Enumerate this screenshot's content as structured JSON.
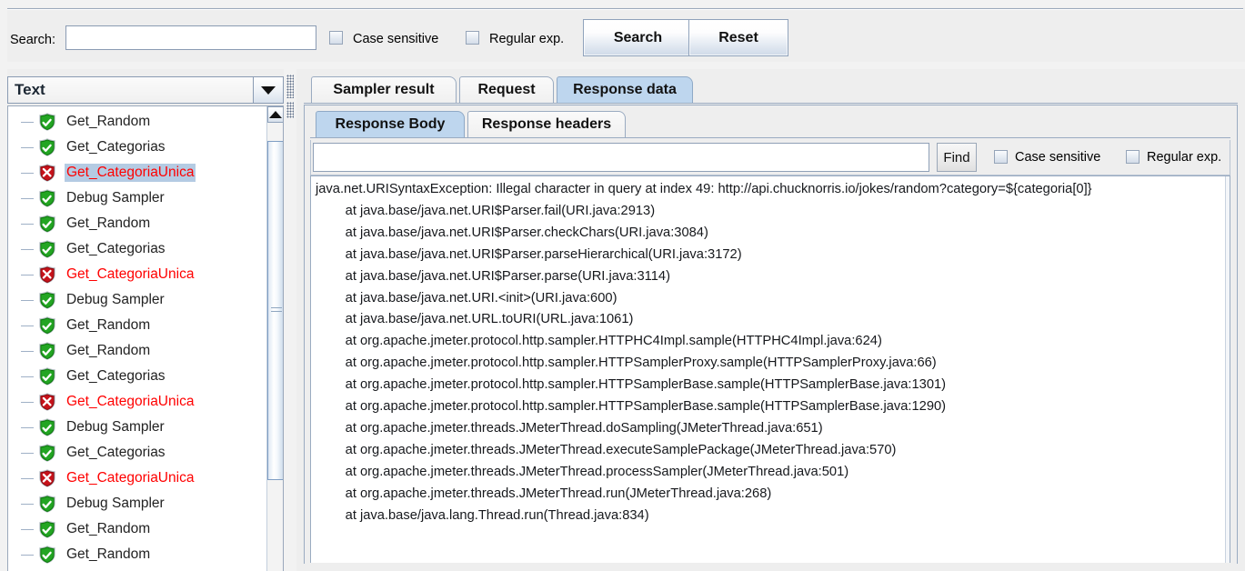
{
  "search_toolbar": {
    "label": "Search:",
    "input_value": "",
    "input_placeholder": "",
    "case_sensitive_label": "Case sensitive",
    "case_sensitive_checked": false,
    "regular_exp_label": "Regular exp.",
    "regular_exp_checked": false,
    "search_button": "Search",
    "reset_button": "Reset"
  },
  "left_panel": {
    "combo_value": "Text",
    "combo_options": [
      "Text"
    ],
    "tree_items": [
      {
        "label": "Get_Random",
        "status": "pass",
        "selected": false
      },
      {
        "label": "Get_Categorias",
        "status": "pass",
        "selected": false
      },
      {
        "label": "Get_CategoriaUnica",
        "status": "fail",
        "selected": true
      },
      {
        "label": "Debug Sampler",
        "status": "pass",
        "selected": false
      },
      {
        "label": "Get_Random",
        "status": "pass",
        "selected": false
      },
      {
        "label": "Get_Categorias",
        "status": "pass",
        "selected": false
      },
      {
        "label": "Get_CategoriaUnica",
        "status": "fail",
        "selected": false
      },
      {
        "label": "Debug Sampler",
        "status": "pass",
        "selected": false
      },
      {
        "label": "Get_Random",
        "status": "pass",
        "selected": false
      },
      {
        "label": "Get_Random",
        "status": "pass",
        "selected": false
      },
      {
        "label": "Get_Categorias",
        "status": "pass",
        "selected": false
      },
      {
        "label": "Get_CategoriaUnica",
        "status": "fail",
        "selected": false
      },
      {
        "label": "Debug Sampler",
        "status": "pass",
        "selected": false
      },
      {
        "label": "Get_Categorias",
        "status": "pass",
        "selected": false
      },
      {
        "label": "Get_CategoriaUnica",
        "status": "fail",
        "selected": false
      },
      {
        "label": "Debug Sampler",
        "status": "pass",
        "selected": false
      },
      {
        "label": "Get_Random",
        "status": "pass",
        "selected": false
      },
      {
        "label": "Get_Random",
        "status": "pass",
        "selected": false
      }
    ],
    "scroll_up_icon": "triangle-up",
    "scroll_thumb_position_pct": 4
  },
  "right_panel": {
    "outer_tabs": [
      {
        "label": "Sampler result",
        "active": false
      },
      {
        "label": "Request",
        "active": false
      },
      {
        "label": "Response data",
        "active": true
      }
    ],
    "inner_tabs": [
      {
        "label": "Response Body",
        "active": true
      },
      {
        "label": "Response headers",
        "active": false
      }
    ],
    "find_bar": {
      "input_value": "",
      "input_placeholder": "",
      "find_button": "Find",
      "case_sensitive_label": "Case sensitive",
      "case_sensitive_checked": false,
      "regular_exp_label": "Regular exp.",
      "regular_exp_checked": false
    },
    "response_body": {
      "first_line": "java.net.URISyntaxException: Illegal character in query at index 49: http://api.chucknorris.io/jokes/random?category=${categoria[0]}",
      "stack_trace": [
        "\tat java.base/java.net.URI$Parser.fail(URI.java:2913)",
        "\tat java.base/java.net.URI$Parser.checkChars(URI.java:3084)",
        "\tat java.base/java.net.URI$Parser.parseHierarchical(URI.java:3172)",
        "\tat java.base/java.net.URI$Parser.parse(URI.java:3114)",
        "\tat java.base/java.net.URI.<init>(URI.java:600)",
        "\tat java.base/java.net.URL.toURI(URL.java:1061)",
        "\tat org.apache.jmeter.protocol.http.sampler.HTTPHC4Impl.sample(HTTPHC4Impl.java:624)",
        "\tat org.apache.jmeter.protocol.http.sampler.HTTPSamplerProxy.sample(HTTPSamplerProxy.java:66)",
        "\tat org.apache.jmeter.protocol.http.sampler.HTTPSamplerBase.sample(HTTPSamplerBase.java:1301)",
        "\tat org.apache.jmeter.protocol.http.sampler.HTTPSamplerBase.sample(HTTPSamplerBase.java:1290)",
        "\tat org.apache.jmeter.threads.JMeterThread.doSampling(JMeterThread.java:651)",
        "\tat org.apache.jmeter.threads.JMeterThread.executeSamplePackage(JMeterThread.java:570)",
        "\tat org.apache.jmeter.threads.JMeterThread.processSampler(JMeterThread.java:501)",
        "\tat org.apache.jmeter.threads.JMeterThread.run(JMeterThread.java:268)",
        "\tat java.base/java.lang.Thread.run(Thread.java:834)"
      ]
    }
  },
  "colors": {
    "pass_green": "#2aa82a",
    "fail_red": "#d01010",
    "fail_text": "#ff0000",
    "selection_blue": "#b4cbe3",
    "active_tab_blue": "#bed6ee",
    "panel_bg": "#eeeeee"
  }
}
